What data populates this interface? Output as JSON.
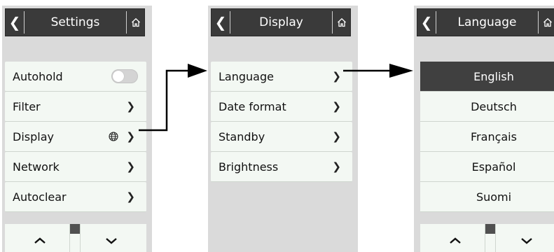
{
  "settings": {
    "title": "Settings",
    "items": [
      {
        "label": "Autohold",
        "control": "toggle",
        "toggle_on": false
      },
      {
        "label": "Filter",
        "control": "chevron"
      },
      {
        "label": "Display",
        "control": "chevron",
        "icon": "globe-icon"
      },
      {
        "label": "Network",
        "control": "chevron"
      },
      {
        "label": "Autoclear",
        "control": "chevron"
      }
    ]
  },
  "display": {
    "title": "Display",
    "items": [
      {
        "label": "Language"
      },
      {
        "label": "Date format"
      },
      {
        "label": "Standby"
      },
      {
        "label": "Brightness"
      }
    ]
  },
  "language": {
    "title": "Language",
    "items": [
      {
        "label": "English",
        "selected": true
      },
      {
        "label": "Deutsch"
      },
      {
        "label": "Français"
      },
      {
        "label": "Español"
      },
      {
        "label": "Suomi"
      }
    ]
  },
  "glyphs": {
    "back": "❮",
    "chevron": "❯"
  },
  "colors": {
    "header_bg": "#3a3a3a",
    "screen_bg": "#dadada",
    "row_bg": "#f3f8f3",
    "selected_bg": "#404040"
  }
}
